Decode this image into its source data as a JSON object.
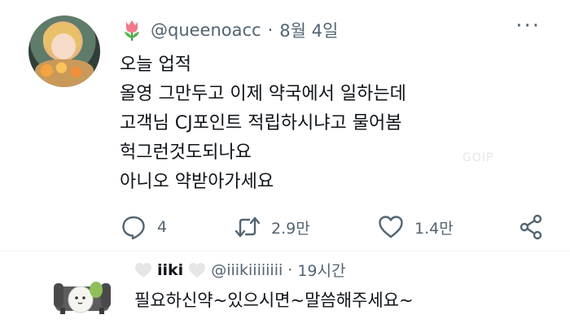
{
  "tweet": {
    "handle": "@queenoacc",
    "date": "8월 4일",
    "lines": [
      "오늘 업적",
      "올영 그만두고 이제 약국에서 일하는데",
      "고객님 CJ포인트 적립하시냐고 물어봄",
      "헉그런것도되나요",
      "아니오 약받아가세요"
    ],
    "more_label": "···"
  },
  "watermark": "GOIP",
  "actions": {
    "reply_count": "4",
    "retweet_count": "2.9만",
    "like_count": "1.4만"
  },
  "reply": {
    "name": "iiki",
    "handle": "@iiikiiiiiiii",
    "time": "19시간",
    "text": "필요하신약~있으시면~말씀해주세요~"
  },
  "colors": {
    "text": "#0f1419",
    "secondary": "#536471",
    "divider": "#eff3f4",
    "tulip": "#f07a8a"
  }
}
